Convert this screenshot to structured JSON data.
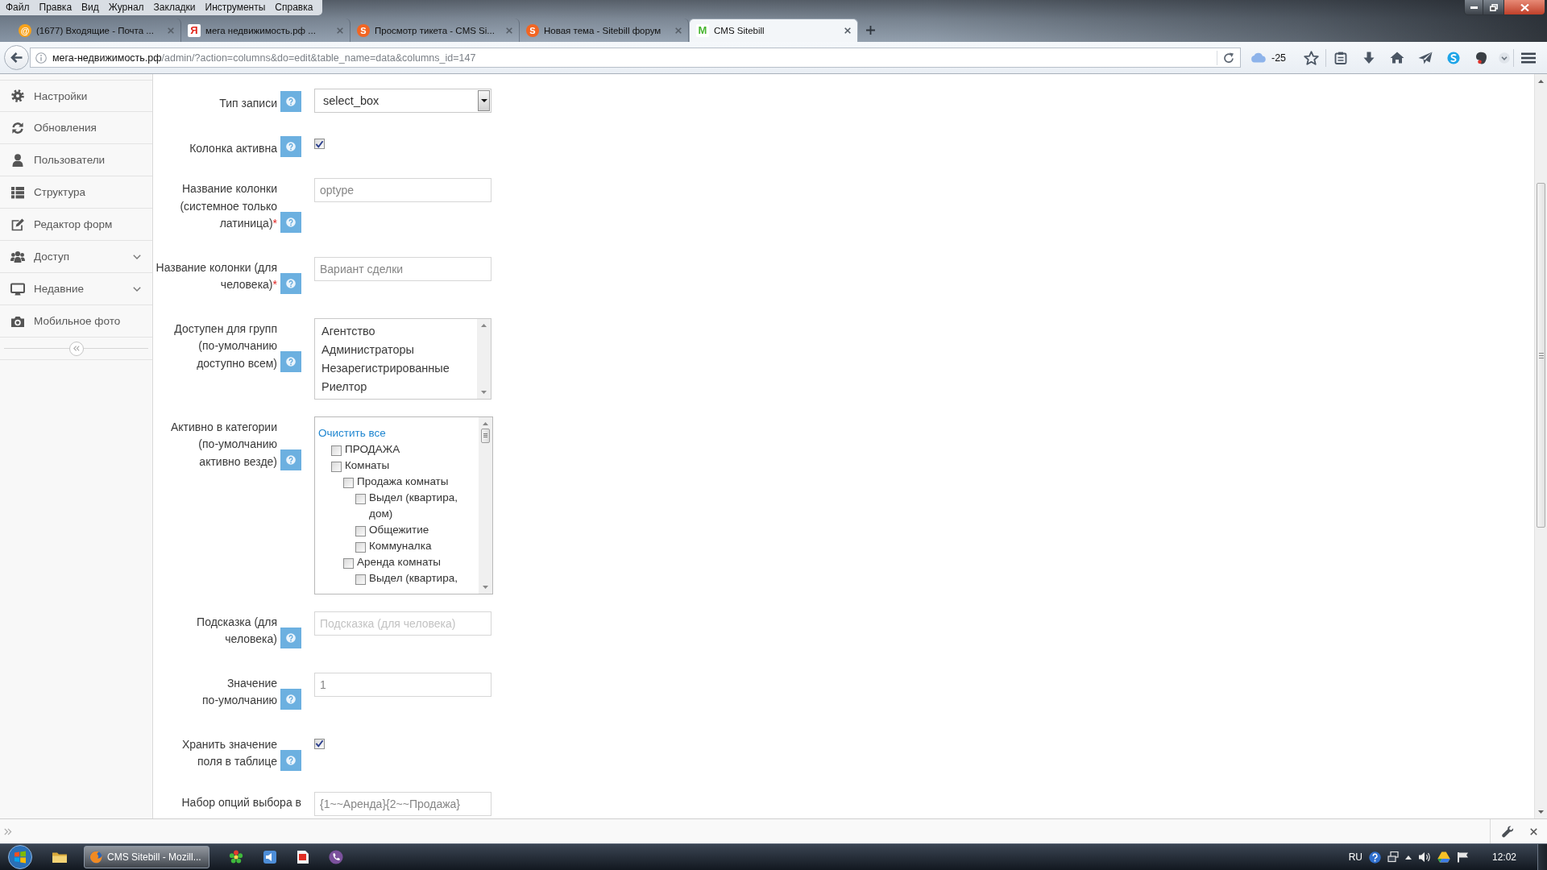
{
  "browser": {
    "menu": [
      "Файл",
      "Правка",
      "Вид",
      "Журнал",
      "Закладки",
      "Инструменты",
      "Справка"
    ],
    "tabs": [
      {
        "title": "(1677) Входящие - Почта ...",
        "favicon": "@",
        "kind": "disc",
        "color": "#f7a21b",
        "selected": false
      },
      {
        "title": "мега недвижимость.рф ...",
        "favicon": "Я",
        "kind": "tile",
        "color": "#e3271c",
        "selected": false
      },
      {
        "title": "Просмотр тикета - CMS Si...",
        "favicon": "S",
        "kind": "disc",
        "color": "#f26522",
        "selected": false
      },
      {
        "title": "Новая тема - Sitebill форум",
        "favicon": "S",
        "kind": "disc",
        "color": "#f26522",
        "selected": false
      },
      {
        "title": "CMS Sitebill",
        "favicon": "M",
        "kind": "tile",
        "color": "#47b530",
        "selected": true
      }
    ],
    "url": {
      "host": "мега-недвижимость.рф",
      "path": "/admin/?action=columns&do=edit&table_name=data&columns_id=147"
    },
    "weather": "-25"
  },
  "sidebar": {
    "items": [
      {
        "label": "Настройки",
        "submenu": false
      },
      {
        "label": "Обновления",
        "submenu": false
      },
      {
        "label": "Пользователи",
        "submenu": false
      },
      {
        "label": "Структура",
        "submenu": false
      },
      {
        "label": "Редактор форм",
        "submenu": false
      },
      {
        "label": "Доступ",
        "submenu": true
      },
      {
        "label": "Недавние",
        "submenu": true
      },
      {
        "label": "Мобильное фото",
        "submenu": false
      }
    ]
  },
  "form": {
    "fields": [
      {
        "kind": "select",
        "label": "Тип записи",
        "help": true,
        "value": "select_box"
      },
      {
        "kind": "checkbox",
        "label": "Колонка активна",
        "help": true,
        "checked": true
      },
      {
        "kind": "text",
        "label": "Название колонки\n(системное только\nлатиница)",
        "required_mark": "*",
        "help": true,
        "value": "optype"
      },
      {
        "kind": "text",
        "label": "Название колонки (для\nчеловека)",
        "required_mark": "*",
        "help": true,
        "value": "Вариант сделки"
      },
      {
        "kind": "multiselect",
        "label": "Доступен для групп\n(по-умолчанию\nдоступно всем)",
        "help": true,
        "options": [
          {
            "label": "Агентство",
            "selected": false
          },
          {
            "label": "Администраторы",
            "selected": false
          },
          {
            "label": "Незарегистрированные",
            "selected": false
          },
          {
            "label": "Риелтор",
            "selected": false
          }
        ]
      },
      {
        "kind": "tree",
        "label": "Активно в категории\n(по-умолчанию\nактивно везде)",
        "help": true,
        "clear_link": "Очистить все",
        "items": [
          {
            "label": "ПРОДАЖА",
            "checked": false
          },
          {
            "label": "Комнаты",
            "checked": false,
            "children": [
              {
                "label": "Продажа комнаты",
                "checked": false,
                "children": [
                  {
                    "label": "Выдел (квартира, дом)",
                    "checked": false
                  },
                  {
                    "label": "Общежитие",
                    "checked": false
                  },
                  {
                    "label": "Коммуналка",
                    "checked": false
                  }
                ]
              },
              {
                "label": "Аренда комнаты",
                "checked": false,
                "children": [
                  {
                    "label": "Выдел (квартира,",
                    "checked": false
                  }
                ]
              }
            ]
          }
        ]
      },
      {
        "kind": "text",
        "label": "Подсказка (для\nчеловека)",
        "help": true,
        "placeholder": "Подсказка (для человека)"
      },
      {
        "kind": "text",
        "label": "Значение\nпо-умолчанию",
        "help": true,
        "value": "1"
      },
      {
        "kind": "checkbox",
        "label": "Хранить значение\nполя в таблице",
        "help": true,
        "checked": true
      },
      {
        "kind": "text",
        "label": "Набор опций выбора в",
        "help": false,
        "value": "{1~~Аренда}{2~~Продажа}"
      }
    ]
  },
  "taskbar": {
    "task": "CMS Sitebill - Mozill...",
    "language": "RU",
    "clock": "12:02"
  }
}
